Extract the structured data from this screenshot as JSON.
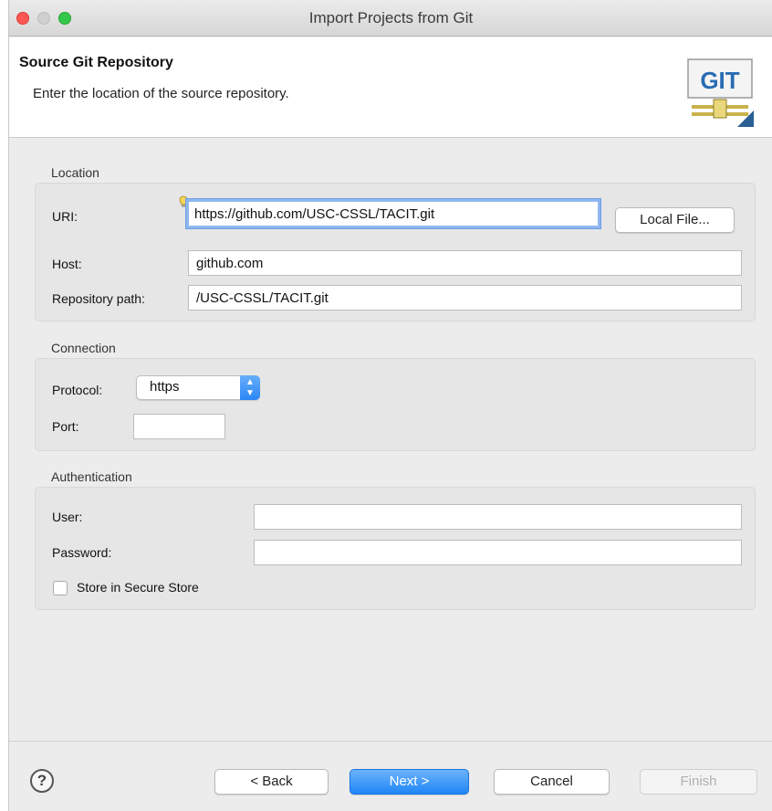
{
  "window": {
    "title": "Import Projects from Git"
  },
  "header": {
    "title": "Source Git Repository",
    "description": "Enter the location of the source repository.",
    "banner_text": "GIT"
  },
  "location": {
    "label": "Location",
    "uri_label": "URI:",
    "uri_value": "https://github.com/USC-CSSL/TACIT.git",
    "local_file_button": "Local File...",
    "host_label": "Host:",
    "host_value": "github.com",
    "repo_path_label": "Repository path:",
    "repo_path_value": "/USC-CSSL/TACIT.git"
  },
  "connection": {
    "label": "Connection",
    "protocol_label": "Protocol:",
    "protocol_value": "https",
    "port_label": "Port:",
    "port_value": ""
  },
  "authentication": {
    "label": "Authentication",
    "user_label": "User:",
    "user_value": "",
    "password_label": "Password:",
    "password_value": "",
    "store_label": "Store in Secure Store",
    "store_checked": false
  },
  "buttons": {
    "help": "?",
    "back": "< Back",
    "next": "Next >",
    "cancel": "Cancel",
    "finish": "Finish"
  },
  "colors": {
    "accent": "#1f86f8",
    "focus_ring": "#8fb7ef",
    "close": "#fc5753",
    "maximize": "#34c84a"
  }
}
